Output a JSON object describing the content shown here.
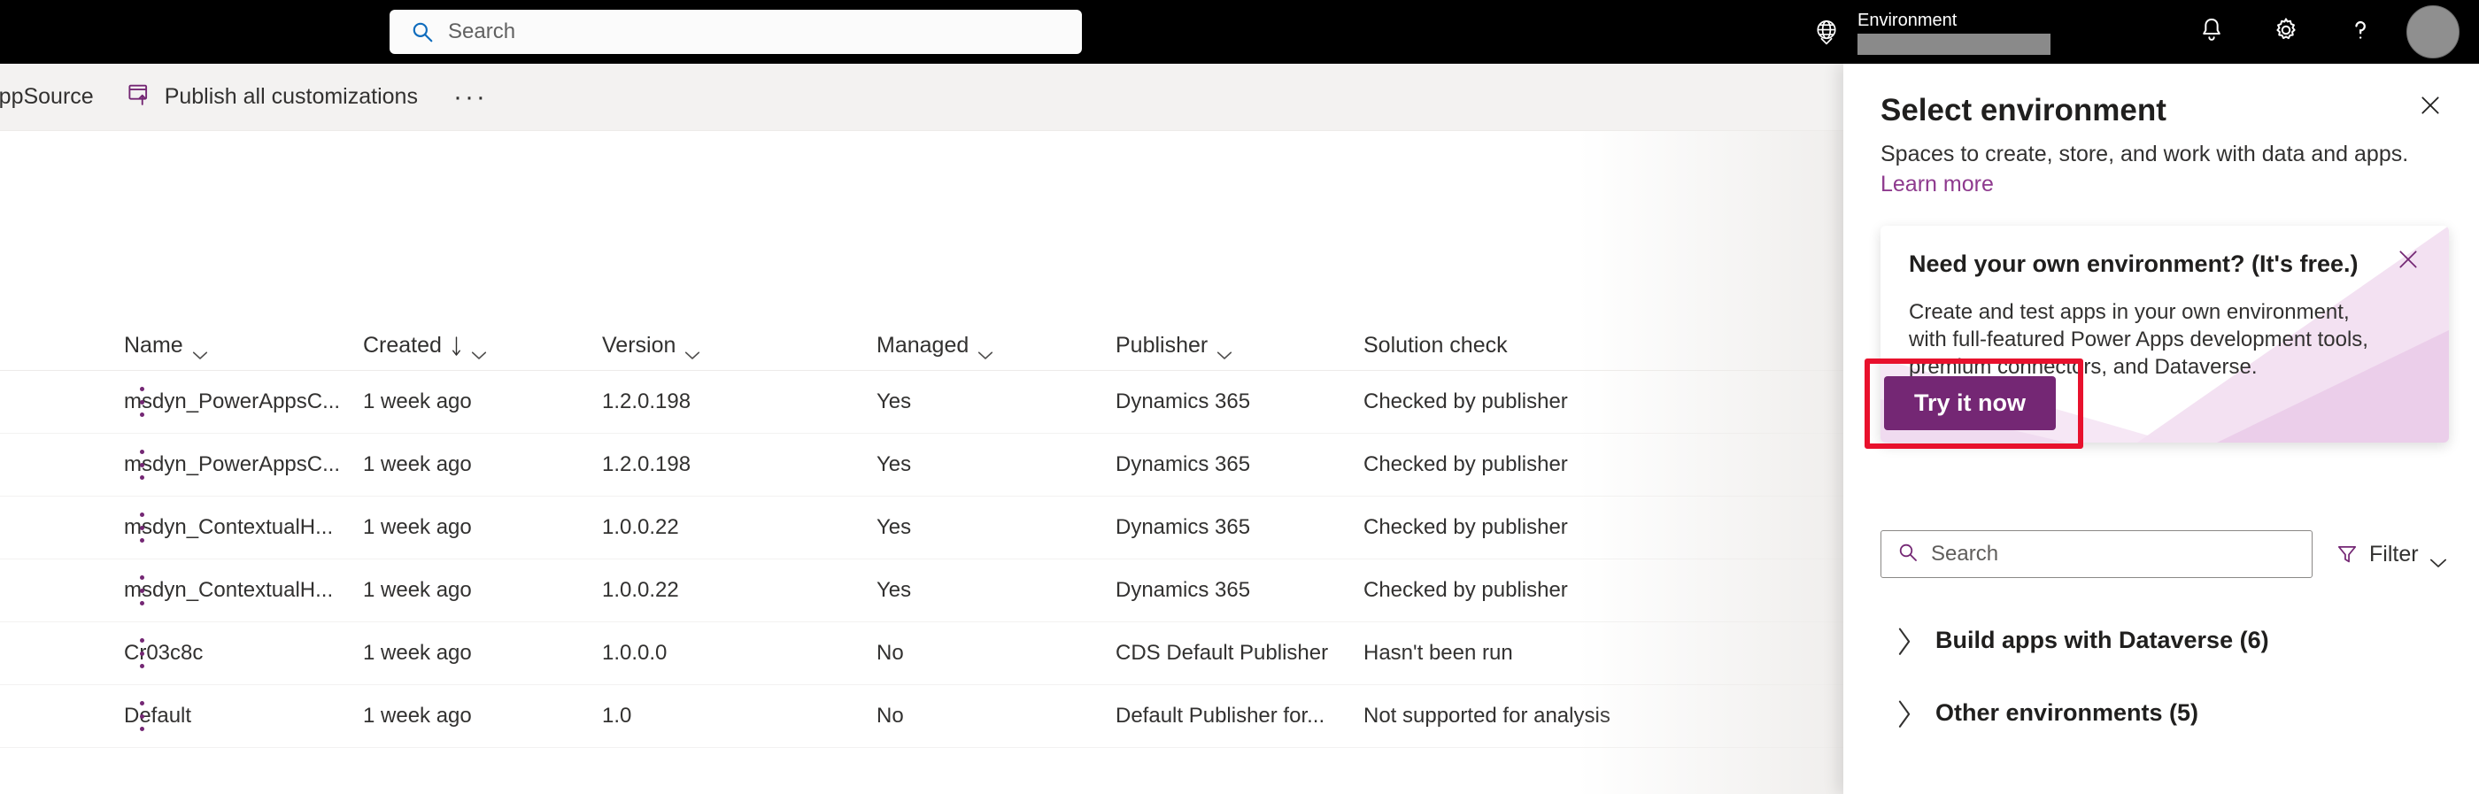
{
  "suite": {
    "search": {
      "placeholder": "Search",
      "icon": "search-icon"
    },
    "environment_label": "Environment",
    "globe_icon": "globe-icon",
    "notifications_icon": "bell-icon",
    "settings_icon": "gear-icon",
    "help_icon": "question-mark-icon",
    "avatar_icon": "avatar"
  },
  "command_bar": {
    "appsource_label": "AppSource",
    "publish_label": "Publish all customizations",
    "publish_icon": "publish-icon",
    "overflow_label": "···"
  },
  "table": {
    "columns": [
      {
        "label": "Name",
        "sortable": true,
        "sorted": false
      },
      {
        "label": "Created",
        "sortable": true,
        "sorted": true
      },
      {
        "label": "Version",
        "sortable": true,
        "sorted": false
      },
      {
        "label": "Managed",
        "sortable": true,
        "sorted": false
      },
      {
        "label": "Publisher",
        "sortable": true,
        "sorted": false
      },
      {
        "label": "Solution check",
        "sortable": false,
        "sorted": false
      }
    ],
    "rows": [
      {
        "name": "msdyn_PowerAppsC...",
        "created": "1 week ago",
        "version": "1.2.0.198",
        "managed": "Yes",
        "publisher": "Dynamics 365",
        "check": "Checked by publisher"
      },
      {
        "name": "msdyn_PowerAppsC...",
        "created": "1 week ago",
        "version": "1.2.0.198",
        "managed": "Yes",
        "publisher": "Dynamics 365",
        "check": "Checked by publisher"
      },
      {
        "name": "msdyn_ContextualH...",
        "created": "1 week ago",
        "version": "1.0.0.22",
        "managed": "Yes",
        "publisher": "Dynamics 365",
        "check": "Checked by publisher"
      },
      {
        "name": "msdyn_ContextualH...",
        "created": "1 week ago",
        "version": "1.0.0.22",
        "managed": "Yes",
        "publisher": "Dynamics 365",
        "check": "Checked by publisher"
      },
      {
        "name": "Cr03c8c",
        "created": "1 week ago",
        "version": "1.0.0.0",
        "managed": "No",
        "publisher": "CDS Default Publisher",
        "check": "Hasn't been run"
      },
      {
        "name": "Default",
        "created": "1 week ago",
        "version": "1.0",
        "managed": "No",
        "publisher": "Default Publisher for...",
        "check": "Not supported for analysis"
      }
    ]
  },
  "panel": {
    "title": "Select environment",
    "subtitle": "Spaces to create, store, and work with data and apps.",
    "learn_more": "Learn more",
    "close_icon": "close-icon",
    "callout": {
      "title": "Need your own environment? (It's free.)",
      "body": "Create and test apps in your own environment, with full-featured Power Apps development tools, premium connectors, and Dataverse.",
      "button_label": "Try it now",
      "close_icon": "close-icon"
    },
    "search": {
      "placeholder": "Search",
      "icon": "search-icon"
    },
    "filter": {
      "label": "Filter",
      "icon": "funnel-icon"
    },
    "groups": [
      {
        "label": "Build apps with Dataverse (6)",
        "expanded": false
      },
      {
        "label": "Other environments (5)",
        "expanded": false
      }
    ]
  },
  "colors": {
    "suite_bar": "#000000",
    "brand_purple": "#742774",
    "link_purple": "#8e3a8e",
    "annotation_red": "#e8112d",
    "command_bar_bg": "#f3f2f1"
  }
}
